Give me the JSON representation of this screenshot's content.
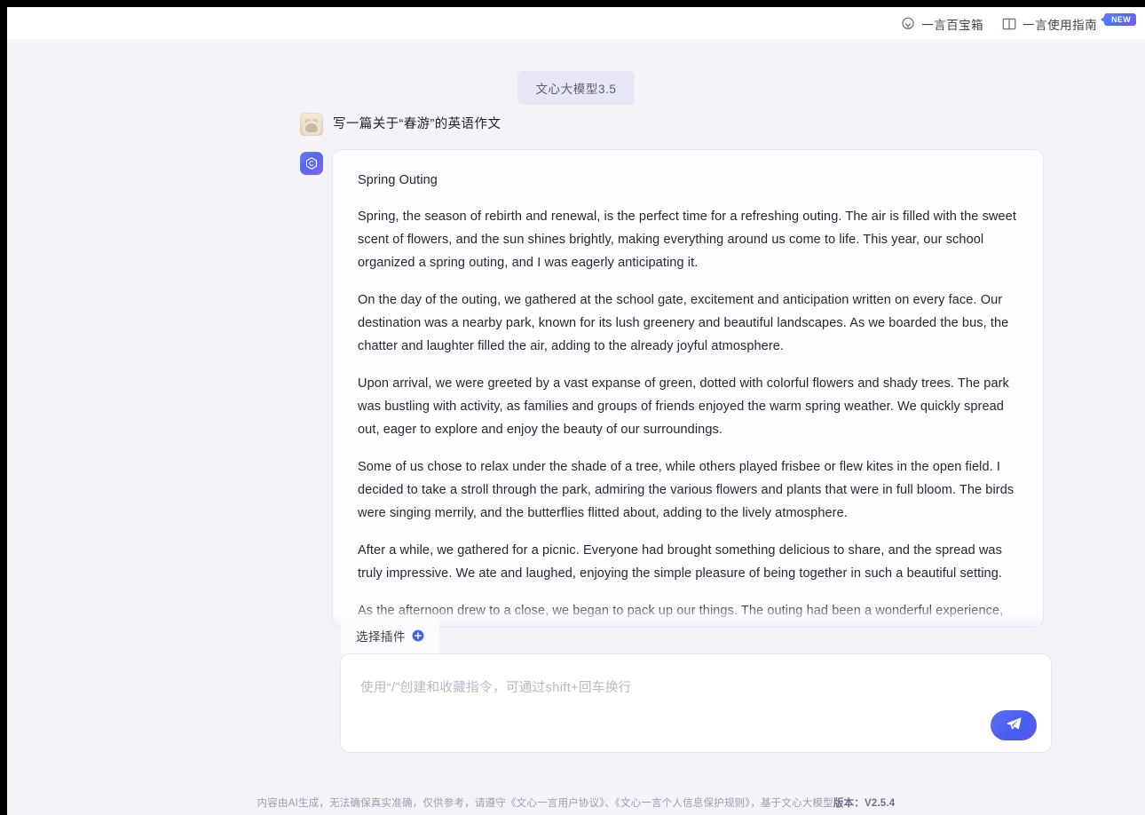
{
  "topbar": {
    "items": [
      {
        "label": "一言百宝箱",
        "icon": "treasure-box-icon"
      },
      {
        "label": "一言使用指南",
        "icon": "book-guide-icon",
        "badge": "NEW"
      }
    ]
  },
  "model_chip": {
    "label": "文心大模型3.5"
  },
  "conversation": {
    "user": {
      "avatar": "user-avatar",
      "message": "写一篇关于“春游”的英语作文"
    },
    "assistant": {
      "avatar": "wenxin-logo-icon",
      "title": "Spring Outing",
      "paragraphs": [
        "Spring, the season of rebirth and renewal, is the perfect time for a refreshing outing. The air is filled with the sweet scent of flowers, and the sun shines brightly, making everything around us come to life. This year, our school organized a spring outing, and I was eagerly anticipating it.",
        "On the day of the outing, we gathered at the school gate, excitement and anticipation written on every face. Our destination was a nearby park, known for its lush greenery and beautiful landscapes. As we boarded the bus, the chatter and laughter filled the air, adding to the already joyful atmosphere.",
        "Upon arrival, we were greeted by a vast expanse of green, dotted with colorful flowers and shady trees. The park was bustling with activity, as families and groups of friends enjoyed the warm spring weather. We quickly spread out, eager to explore and enjoy the beauty of our surroundings.",
        "Some of us chose to relax under the shade of a tree, while others played frisbee or flew kites in the open field. I decided to take a stroll through the park, admiring the various flowers and plants that were in full bloom. The birds were singing merrily, and the butterflies flitted about, adding to the lively atmosphere.",
        "After a while, we gathered for a picnic. Everyone had brought something delicious to share, and the spread was truly impressive. We ate and laughed, enjoying the simple pleasure of being together in such a beautiful setting.",
        "As the afternoon drew to a close, we began to pack up our things. The outing had been a wonderful experience, and I was already looking forward to the next one. As we boarded the bus back to school, I couldn't help but"
      ]
    }
  },
  "composer": {
    "plugin_button_label": "选择插件",
    "plugin_icon": "plus-circle-icon",
    "input_placeholder": "使用“/”创建和收藏指令，可通过shift+回车换行",
    "send_icon": "send-paper-plane-icon"
  },
  "footer": {
    "disclaimer_1": "内容由AI生成，无法确保真实准确，仅供参考，请遵守",
    "link_1": "《文心一言用户协议》",
    "separator_1": "、",
    "link_2": "《文心一言个人信息保护规则》",
    "separator_2": "，",
    "disclaimer_2": "基于文心大模型",
    "version": "版本：V2.5.4"
  },
  "colors": {
    "accent": "#4e6ef2",
    "stage_bg": "#f3f3f8",
    "card_bg": "#fdfdff",
    "chip_bg": "#e6e6f4",
    "text": "#26282d",
    "muted": "#9ea0ae"
  }
}
